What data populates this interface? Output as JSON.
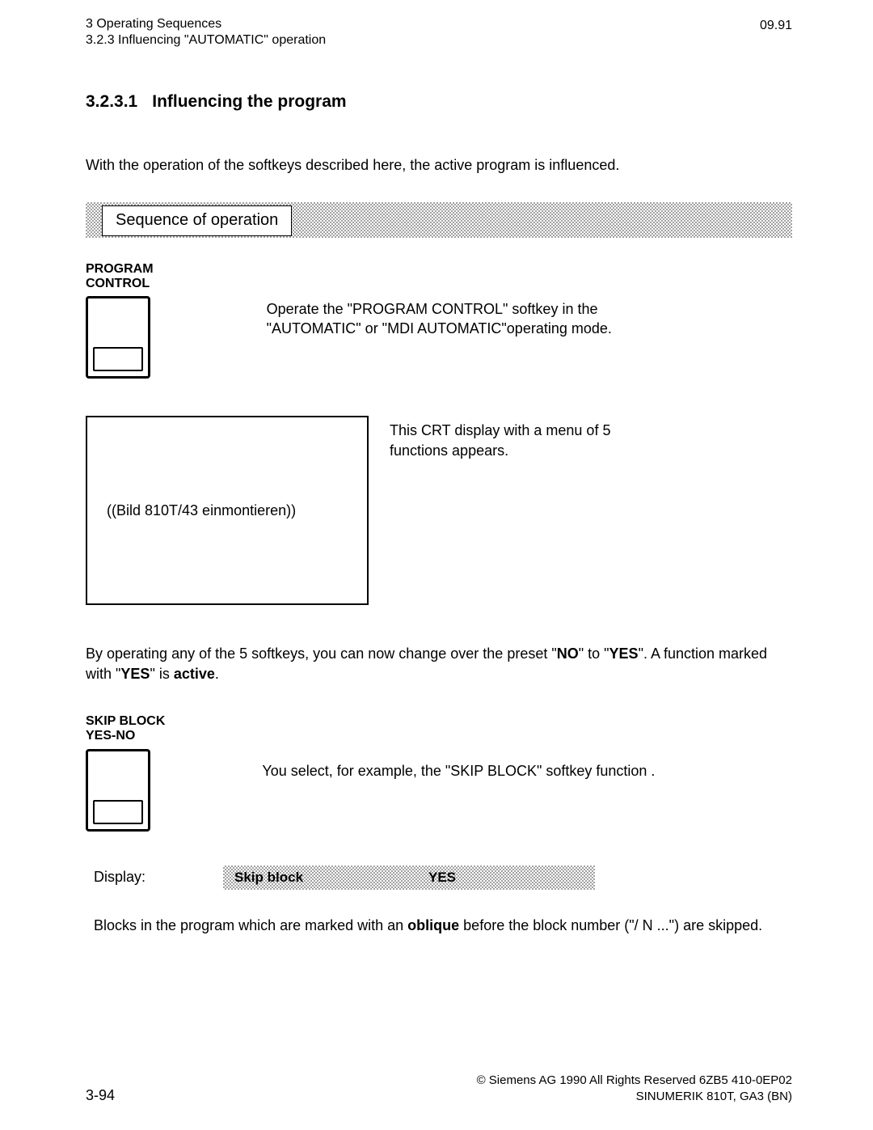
{
  "header": {
    "chapter": "3  Operating Sequences",
    "subsection": "3.2.3  Influencing \"AUTOMATIC\" operation",
    "date": "09.91"
  },
  "section": {
    "number": "3.2.3.1",
    "title": "Influencing the program"
  },
  "intro": "With the operation of the softkeys described here, the active program is influenced.",
  "sequence_label": "Sequence of operation",
  "softkey1": {
    "label_line1": "PROGRAM",
    "label_line2": "CONTROL"
  },
  "softkey1_text_line1": "Operate the \"PROGRAM CONTROL\" softkey in the",
  "softkey1_text_line2": "\"AUTOMATIC\" or \"MDI AUTOMATIC\"operating mode.",
  "crt_placeholder": "((Bild  810T/43 einmontieren))",
  "crt_text_line1": "This CRT display with a menu of 5",
  "crt_text_line2": "functions appears.",
  "para2_part1": "By operating any of the 5 softkeys, you can now change over the preset \"",
  "para2_no": "NO",
  "para2_part2": "\" to \"",
  "para2_yes": "YES",
  "para2_part3": "\". A function marked with \"",
  "para2_yes2": "YES",
  "para2_part4": "\" is ",
  "para2_active": "active",
  "para2_part5": ".",
  "softkey2": {
    "label_line1": "SKIP BLOCK",
    "label_line2": "YES-NO"
  },
  "softkey2_text": "You select, for example, the \"SKIP BLOCK\" softkey function .",
  "display": {
    "label": "Display:",
    "field": "Skip block",
    "value": "YES"
  },
  "para3_part1": "Blocks in the program which are marked with an ",
  "para3_bold": "oblique",
  "para3_part2": " before the block number (\"/ N ...\") are skipped.",
  "footer": {
    "page": "3-94",
    "copyright": "© Siemens AG 1990 All Rights Reserved    6ZB5 410-0EP02",
    "product": "SINUMERIK 810T, GA3 (BN)"
  }
}
